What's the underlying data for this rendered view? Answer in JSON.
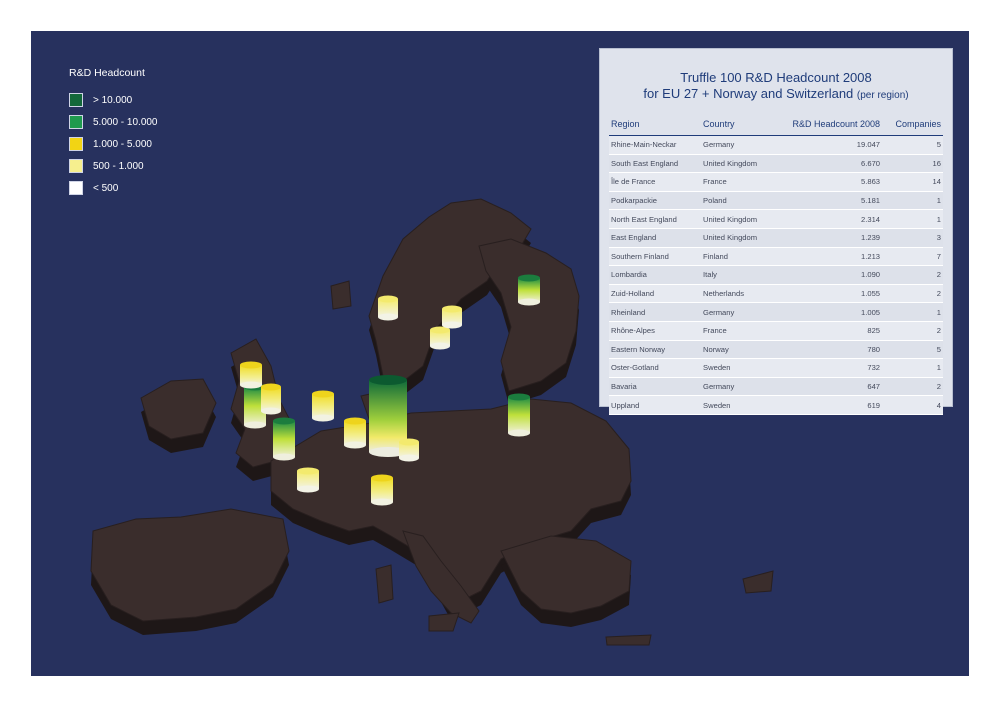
{
  "legend": {
    "title": "R&D Headcount",
    "items": [
      {
        "label": "> 10.000",
        "color": "#13683a"
      },
      {
        "label": "5.000 - 10.000",
        "color": "#1f9a4e"
      },
      {
        "label": "1.000 - 5.000",
        "color": "#f2d414"
      },
      {
        "label": "500 - 1.000",
        "color": "#f6ef8e"
      },
      {
        "label": "< 500",
        "color": "#ffffff"
      }
    ]
  },
  "table_panel": {
    "title_line1": "Truffle 100 R&D Headcount 2008",
    "title_line2": "for EU 27 + Norway and Switzerland",
    "title_note": "(per region)",
    "columns": [
      "Region",
      "Country",
      "R&D Headcount 2008",
      "Companies"
    ],
    "rows": [
      [
        "Rhine-Main-Neckar",
        "Germany",
        "19.047",
        "5"
      ],
      [
        "South East England",
        "United Kingdom",
        "6.670",
        "16"
      ],
      [
        "Île de France",
        "France",
        "5.863",
        "14"
      ],
      [
        "Podkarpackie",
        "Poland",
        "5.181",
        "1"
      ],
      [
        "North East England",
        "United Kingdom",
        "2.314",
        "1"
      ],
      [
        "East England",
        "United Kingdom",
        "1.239",
        "3"
      ],
      [
        "Southern Finland",
        "Finland",
        "1.213",
        "7"
      ],
      [
        "Lombardia",
        "Italy",
        "1.090",
        "2"
      ],
      [
        "Zuid-Holland",
        "Netherlands",
        "1.055",
        "2"
      ],
      [
        "Rheinland",
        "Germany",
        "1.005",
        "1"
      ],
      [
        "Rhône-Alpes",
        "France",
        "825",
        "2"
      ],
      [
        "Eastern Norway",
        "Norway",
        "780",
        "5"
      ],
      [
        "Oster-Gotland",
        "Sweden",
        "732",
        "1"
      ],
      [
        "Bavaria",
        "Germany",
        "647",
        "2"
      ],
      [
        "Uppland",
        "Sweden",
        "619",
        "4"
      ]
    ]
  },
  "map": {
    "background_color": "#27315e",
    "land_color": "#3a2d2c"
  }
}
